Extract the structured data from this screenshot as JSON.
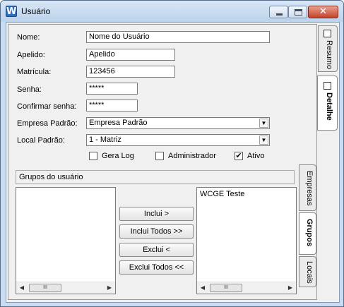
{
  "window": {
    "title": "Usuário",
    "icon": "W"
  },
  "form": {
    "nome_label": "Nome:",
    "nome_value": "Nome do Usuário",
    "apelido_label": "Apelido:",
    "apelido_value": "Apelido",
    "matricula_label": "Matrícula:",
    "matricula_value": "123456",
    "senha_label": "Senha:",
    "senha_value": "*****",
    "confirmar_label": "Confirmar senha:",
    "confirmar_value": "*****",
    "empresa_label": "Empresa Padrão:",
    "empresa_value": "Empresa Padrão",
    "local_label": "Local Padrão:",
    "local_value": "1 - Matriz",
    "checkboxes": [
      {
        "label": "Gera Log",
        "checked": false
      },
      {
        "label": "Administrador",
        "checked": false
      },
      {
        "label": "Ativo",
        "checked": true
      }
    ]
  },
  "groups": {
    "header": "Grupos do usuário",
    "available": [],
    "assigned": [
      "WCGE  Teste"
    ],
    "buttons": {
      "include": "Inclui >",
      "include_all": "Inclui Todos >>",
      "exclude": "Exclui <",
      "exclude_all": "Exclui Todos <<"
    },
    "scroll_thumb": "III"
  },
  "side_tabs": [
    {
      "label": "Resumo",
      "active": false
    },
    {
      "label": "Detalhe",
      "active": true
    }
  ],
  "inner_tabs": [
    {
      "label": "Empresas",
      "active": false
    },
    {
      "label": "Grupos",
      "active": true
    },
    {
      "label": "Locais",
      "active": false
    }
  ],
  "glyphs": {
    "check": "✔",
    "arrow_down": "▼",
    "arrow_left": "◀",
    "arrow_right": "▶",
    "close": "✕"
  }
}
